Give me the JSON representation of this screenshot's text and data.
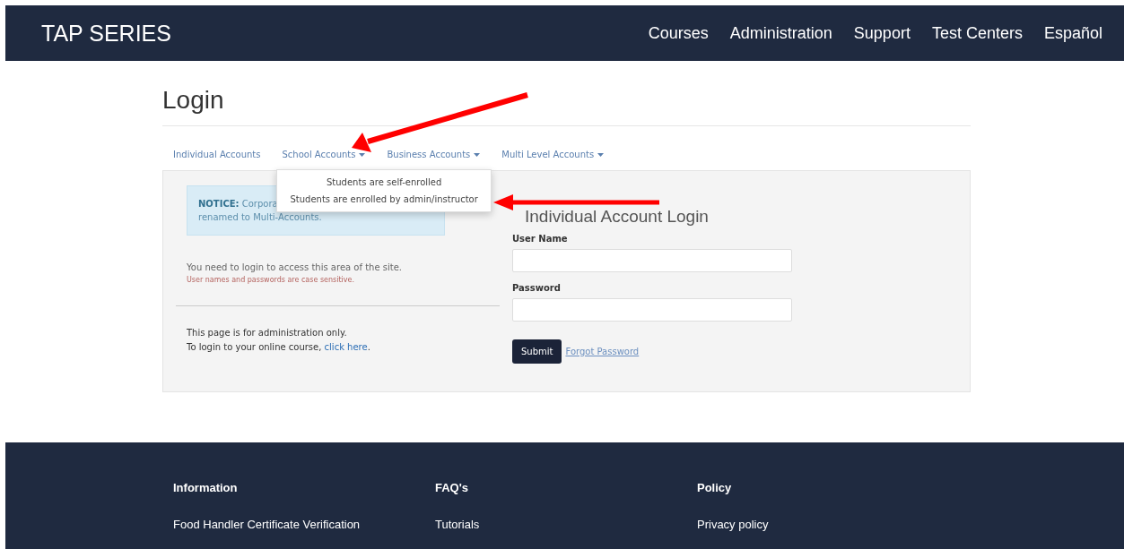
{
  "header": {
    "brand": "TAP SERIES",
    "nav": [
      "Courses",
      "Administration",
      "Support",
      "Test Centers",
      "Español"
    ]
  },
  "page_title": "Login",
  "account_tabs": [
    {
      "label": "Individual Accounts",
      "dropdown": false
    },
    {
      "label": "School Accounts",
      "dropdown": true,
      "expanded": true,
      "menu": [
        "Students are self-enrolled",
        "Students are enrolled by admin/instructor"
      ]
    },
    {
      "label": "Business Accounts",
      "dropdown": true,
      "expanded": false
    },
    {
      "label": "Multi Level Accounts",
      "dropdown": true,
      "expanded": false
    }
  ],
  "notice": {
    "line_1": "**NOTICE:** Corpora",
    "line_2": "renamed to Multi-Accounts."
  },
  "login_message": "You need to login to access this area of the site.",
  "case_note": "User names and passwords are case sensitive.",
  "admin_note": {
    "line_1": "This page is for administration only.",
    "line_2_prefix": "To login to your online course,",
    "link": "click here",
    "suffix": "."
  },
  "form": {
    "title": "Individual Account Login",
    "fields": [
      {
        "label": "User Name"
      },
      {
        "label": "Password"
      }
    ],
    "submit": "Submit",
    "forgot": "Forgot Password"
  },
  "footer": {
    "columns": [
      {
        "title": "Information",
        "links": [
          "Food Handler Certificate Verification"
        ]
      },
      {
        "title": "FAQ's",
        "links": [
          "Tutorials"
        ]
      },
      {
        "title": "Policy",
        "links": [
          "Privacy policy"
        ]
      }
    ]
  }
}
